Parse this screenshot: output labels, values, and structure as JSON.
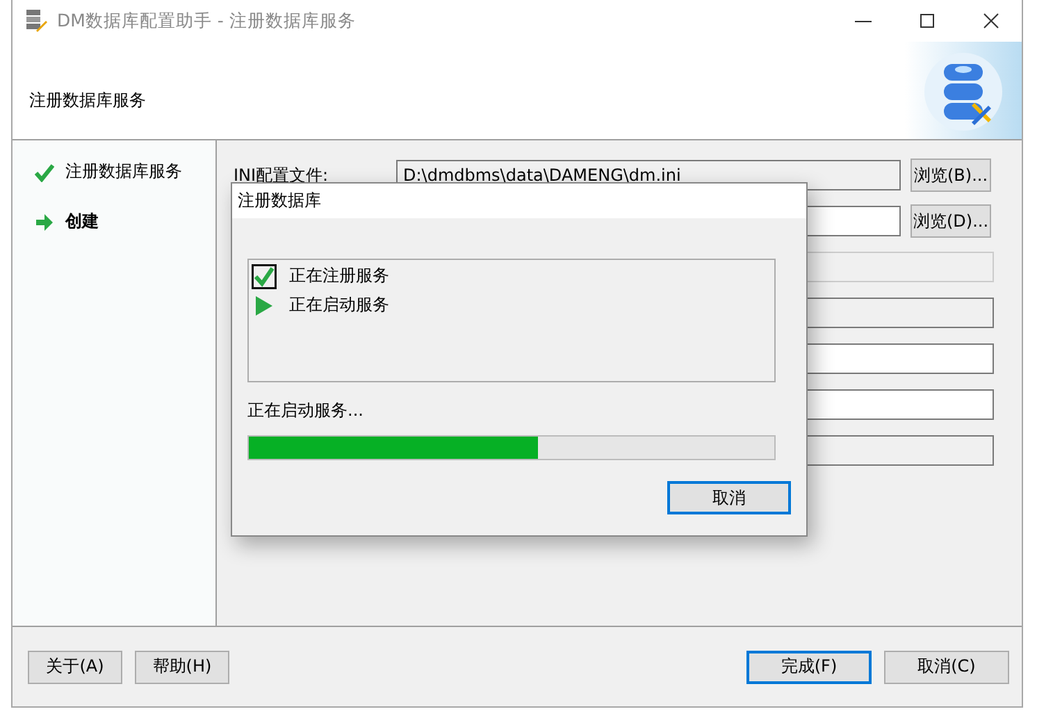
{
  "window": {
    "title": "DM数据库配置助手 - 注册数据库服务"
  },
  "header": {
    "title": "注册数据库服务"
  },
  "steps": [
    {
      "label": "注册数据库服务",
      "kind": "done"
    },
    {
      "label": "创建",
      "kind": "current"
    }
  ],
  "form": {
    "rows": [
      {
        "label": "INI配置文件:",
        "value": "D:\\dmdbms\\data\\DAMENG\\dm.ini",
        "button": "浏览(B)...",
        "kind": "editable"
      },
      {
        "value": "",
        "button": "浏览(D)...",
        "kind": "editable"
      },
      {
        "kind": "disabled"
      },
      {
        "kind": "readonly"
      },
      {
        "kind": "editable"
      },
      {
        "kind": "editable"
      },
      {
        "kind": "readonly"
      }
    ]
  },
  "footer": {
    "left_buttons": [
      "关于(A)",
      "帮助(H)"
    ],
    "finish": {
      "label": "完成(F)",
      "focused": true
    },
    "cancel": "取消(C)"
  },
  "dialog": {
    "title": "注册数据库",
    "tasks": [
      {
        "label": "正在注册服务",
        "kind": "done"
      },
      {
        "label": "正在启动服务",
        "kind": "running"
      }
    ],
    "status": "正在启动服务...",
    "progress": {
      "level": 0.55
    },
    "cancel": "取消"
  }
}
